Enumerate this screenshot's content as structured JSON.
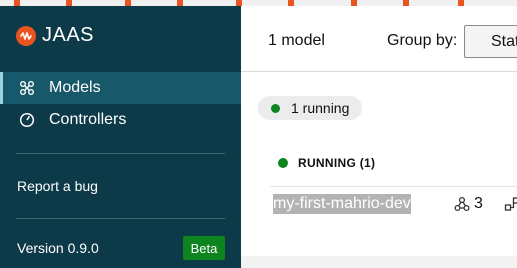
{
  "sidebar": {
    "brand": "JAAS",
    "nav": [
      {
        "label": "Models",
        "icon": "models-icon",
        "active": true
      },
      {
        "label": "Controllers",
        "icon": "controllers-icon",
        "active": false
      }
    ],
    "report_bug": "Report a bug",
    "version": "Version 0.9.0",
    "badge": "Beta"
  },
  "header": {
    "model_count": "1 model",
    "group_by_label": "Group by:",
    "group_by_value": "Status"
  },
  "filter_chip": {
    "label": "1 running"
  },
  "group": {
    "heading": "RUNNING (1)",
    "rows": [
      {
        "name": "my-first-mahrio-dev",
        "units": "3"
      }
    ]
  },
  "colors": {
    "sidebar_bg": "#0c3a48",
    "active_item_bg": "#17586a",
    "brand_accent": "#e95420",
    "status_running": "#0e8420",
    "badge_bg": "#0e8420"
  }
}
